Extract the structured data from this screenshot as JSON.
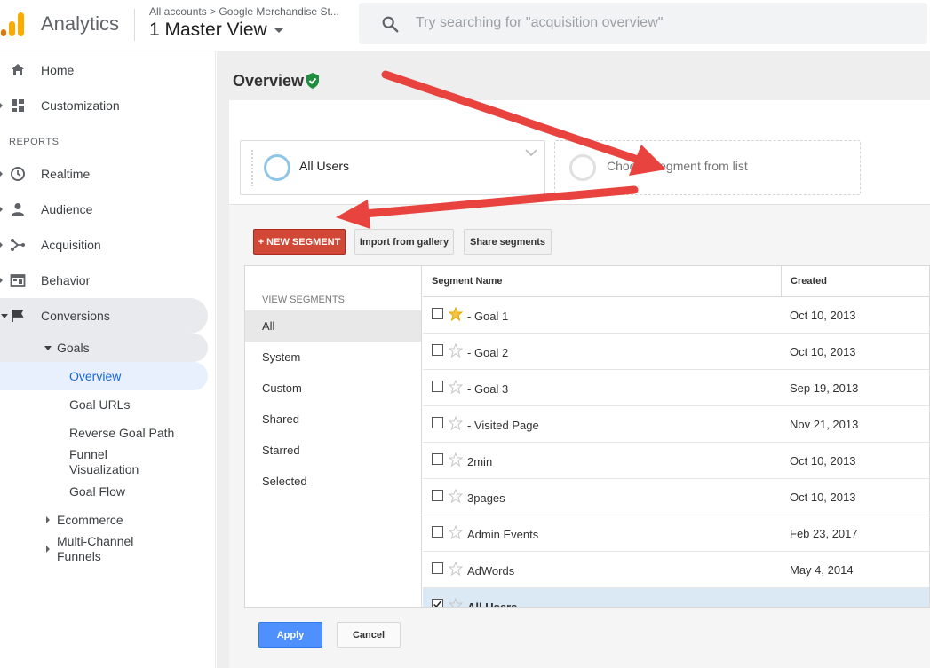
{
  "header": {
    "app_name": "Analytics",
    "breadcrumb": "All accounts > Google Merchandise St...",
    "view_name": "1 Master View",
    "search_placeholder": "Try searching for \"acquisition overview\""
  },
  "sidebar": {
    "top_items": [
      {
        "label": "Home",
        "icon": "home-icon"
      },
      {
        "label": "Customization",
        "icon": "dashboard-icon"
      }
    ],
    "reports_heading": "REPORTS",
    "report_items": [
      {
        "label": "Realtime",
        "icon": "clock-icon"
      },
      {
        "label": "Audience",
        "icon": "person-icon"
      },
      {
        "label": "Acquisition",
        "icon": "acquisition-icon"
      },
      {
        "label": "Behavior",
        "icon": "behavior-icon"
      },
      {
        "label": "Conversions",
        "icon": "flag-icon"
      }
    ],
    "goals": {
      "label": "Goals",
      "items": [
        "Overview",
        "Goal URLs",
        "Reverse Goal Path",
        "Funnel Visualization",
        "Goal Flow"
      ]
    },
    "ecommerce": "Ecommerce",
    "multichannel": "Multi-Channel Funnels"
  },
  "main": {
    "title": "Overview",
    "segment_selected": "All Users",
    "segment_empty": "Choose segment from list"
  },
  "segment_panel": {
    "new_segment_label": "+ NEW SEGMENT",
    "import_label": "Import from gallery",
    "share_label": "Share segments",
    "view_segments_heading": "VIEW SEGMENTS",
    "categories": [
      "All",
      "System",
      "Custom",
      "Shared",
      "Starred",
      "Selected"
    ],
    "selected_category": "All",
    "columns": {
      "name": "Segment Name",
      "created": "Created"
    },
    "rows": [
      {
        "name": "- Goal 1",
        "created": "Oct 10, 2013",
        "starred": true,
        "checked": false
      },
      {
        "name": "- Goal 2",
        "created": "Oct 10, 2013",
        "starred": false,
        "checked": false
      },
      {
        "name": "- Goal 3",
        "created": "Sep 19, 2013",
        "starred": false,
        "checked": false
      },
      {
        "name": "- Visited Page",
        "created": "Nov 21, 2013",
        "starred": false,
        "checked": false
      },
      {
        "name": "2min",
        "created": "Oct 10, 2013",
        "starred": false,
        "checked": false
      },
      {
        "name": "3pages",
        "created": "Oct 10, 2013",
        "starred": false,
        "checked": false
      },
      {
        "name": "Admin Events",
        "created": "Feb 23, 2017",
        "starred": false,
        "checked": false
      },
      {
        "name": "AdWords",
        "created": "May 4, 2014",
        "starred": false,
        "checked": false
      },
      {
        "name": "All Users",
        "created": "",
        "starred": false,
        "checked": true
      }
    ],
    "apply_label": "Apply",
    "cancel_label": "Cancel"
  },
  "colors": {
    "brand_orange": "#f9ab00",
    "brand_orange_dark": "#e37400",
    "new_segment_red": "#d14836",
    "apply_blue": "#4d90fe",
    "active_nav": "#1967d2",
    "arrow_red": "#e8433f"
  }
}
